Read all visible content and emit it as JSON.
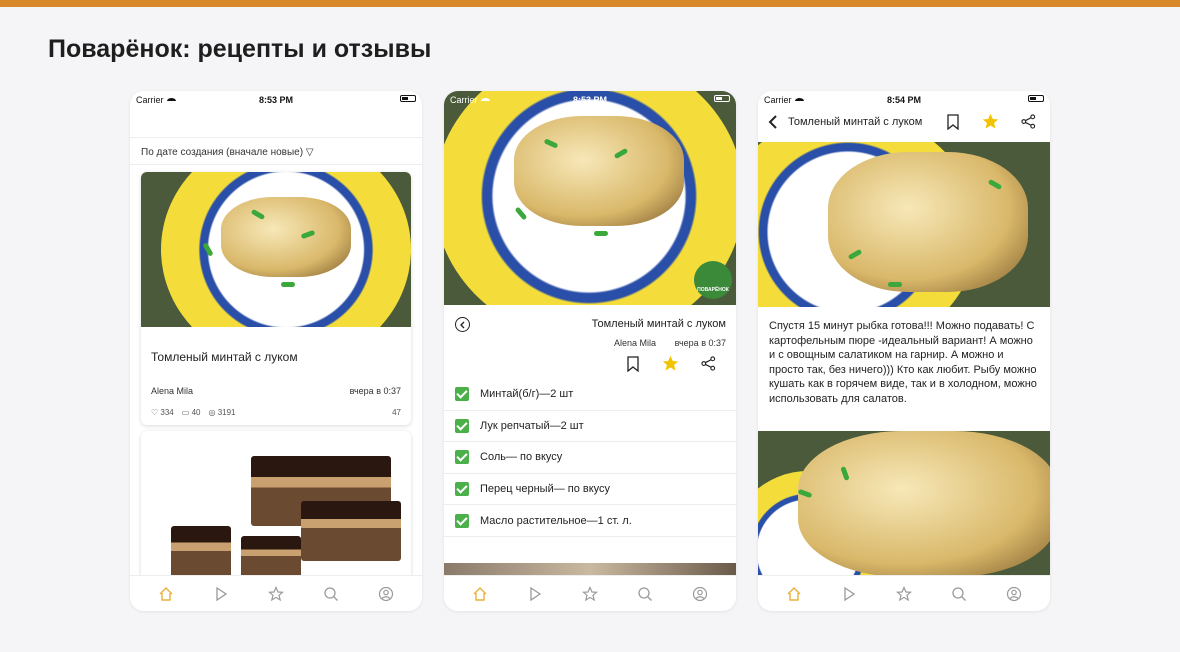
{
  "page_title": "Поварёнок: рецепты и отзывы",
  "colors": {
    "accent": "#d88a2a",
    "star": "#f2c300",
    "check": "#4cb04a",
    "tab_active": "#e8b23a",
    "tab_inactive": "#9a9a9a"
  },
  "status_bar": {
    "carrier": "Carrier",
    "time_1": "8:53 PM",
    "time_2": "8:53 PM",
    "time_3": "8:54 PM"
  },
  "feed": {
    "sort_label": "По дате создания (вначале новые) ▽",
    "cards": [
      {
        "title": "Томленый минтай с луком",
        "author": "Alena Mila",
        "time": "вчера в 0:37",
        "likes": "334",
        "comments": "40",
        "views": "3191",
        "total": "47"
      }
    ]
  },
  "recipe": {
    "title": "Томленый минтай с луком",
    "author": "Alena Mila",
    "time": "вчера в 0:37",
    "ingredients": [
      "Минтай(б/г)—2 шт",
      "Лук репчатый—2 шт",
      "Соль— по вкусу",
      "Перец черный— по вкусу",
      "Масло растительное—1 ст. л."
    ]
  },
  "step": {
    "title": "Томленый минтай с луком",
    "text": "Спустя 15 минут рыбка готова!!! Можно подавать! С картофельным пюре -идеальный вариант! А можно и с овощным салатиком на гарнир. А можно и просто так, без ничего))) Кто как любит. Рыбу можно кушать как в горячем виде, так и в холодном, можно использовать для салатов."
  },
  "watermark": "ПОВАРЁНОК",
  "tabbar": [
    "home-icon",
    "play-icon",
    "star-icon",
    "search-icon",
    "profile-icon"
  ]
}
